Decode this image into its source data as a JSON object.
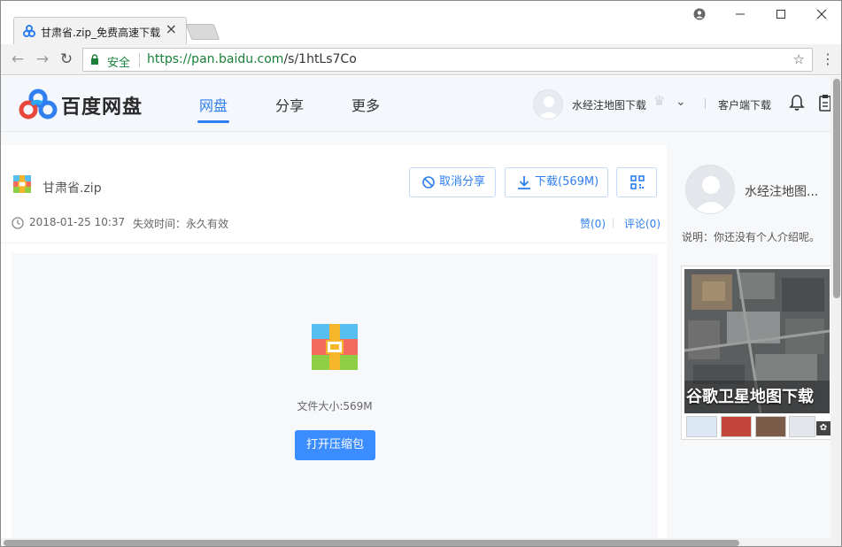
{
  "browser": {
    "tab_title": "甘肃省.zip_免费高速下载",
    "tab_close": "×",
    "secure_label": "安全",
    "url_scheme_host": "https://pan.baidu.com",
    "url_path": "/s/1htLs7Co",
    "icons": [
      "back-icon",
      "forward-icon",
      "reload-icon",
      "lock-icon",
      "star-icon",
      "menu-icon",
      "profile-icon",
      "minimize-icon",
      "maximize-icon",
      "close-icon"
    ]
  },
  "header": {
    "logo_text": "百度网盘",
    "nav": [
      {
        "label": "网盘",
        "active": true
      },
      {
        "label": "分享",
        "active": false
      },
      {
        "label": "更多",
        "active": false
      }
    ],
    "username": "水经注地图下载",
    "client_download": "客户端下载",
    "accent_color": "#2f7ff0"
  },
  "file": {
    "name": "甘肃省.zip",
    "cancel_share": "取消分享",
    "download": "下载(569M)",
    "share_date": "2018-01-25 10:37",
    "expire": "失效时间：永久有效",
    "likes": "赞(0)",
    "comments": "评论(0)",
    "size_text": "文件大小:569M",
    "open_zip": "打开压缩包"
  },
  "sidebar": {
    "username": "水经注地图...",
    "bio": "说明：你还没有个人介绍呢。",
    "ad_title": "谷歌卫星地图下载"
  }
}
